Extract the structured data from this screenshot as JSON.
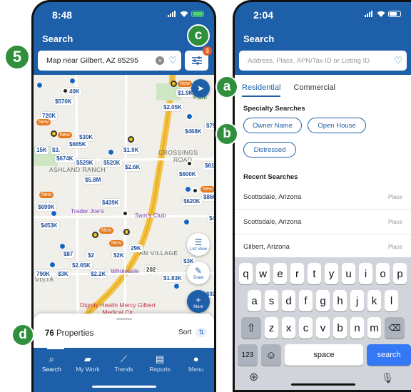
{
  "left_phone": {
    "status": {
      "time": "8:48"
    },
    "title": "Search",
    "search": {
      "value": "Map near Gilbert, AZ 85295",
      "clear_glyph": "×"
    },
    "filter_badge": "3",
    "map": {
      "price_pins": [
        "40K",
        "$570K",
        "720K",
        "$1.9K",
        "$2.05K",
        "Park",
        "New",
        "$30K",
        "$665K",
        "15K",
        "$3.",
        "$674K",
        "$529K",
        "$520K",
        "$1.9K",
        "$2.6K",
        "CROSSINGS",
        "$600K",
        "$610",
        "$468K",
        "$79",
        "$5.8M",
        "$860K",
        "$620K",
        "$439K",
        "$690K",
        "$453K",
        "$4",
        "$87",
        "$2",
        "29K",
        "$2.65K",
        "$2.2K",
        "$2K",
        "$3K",
        "790K",
        "$3K",
        "$1.83K",
        "$92"
      ],
      "new_tags": [
        "New",
        "New",
        "New",
        "New",
        "New",
        "New",
        "New"
      ],
      "labels": {
        "ashland": "ASHLAND RANCH",
        "village": "AN VILLAGE",
        "wholesale": "Wholesale",
        "vista": "VISTA",
        "road": "ROAD"
      },
      "pois": {
        "traderjoes": "Trader Joe's",
        "samsclub": "Sam's Club",
        "hospital": "Dignity Health Mercy Gilbert Medical Ctr",
        "hwy": "202"
      },
      "fabs": {
        "list_view": "List View",
        "draw": "Draw",
        "more": "More"
      }
    },
    "sheet": {
      "count": "76",
      "count_label": "Properties",
      "sort": "Sort"
    },
    "tabs": [
      {
        "label": "Search",
        "icon": "search-icon"
      },
      {
        "label": "My Work",
        "icon": "briefcase-icon"
      },
      {
        "label": "Trends",
        "icon": "chart-icon"
      },
      {
        "label": "Reports",
        "icon": "document-icon"
      },
      {
        "label": "Menu",
        "icon": "menu-icon"
      }
    ]
  },
  "right_phone": {
    "status": {
      "time": "2:04"
    },
    "title": "Search",
    "search": {
      "placeholder": "Address, Place, APN/Tax ID or Listing ID"
    },
    "segments": [
      "Residential",
      "Commercial"
    ],
    "specialty_heading": "Specialty Searches",
    "chips": [
      "Owner Name",
      "Open House",
      "Distressed"
    ],
    "recent_heading": "Recent Searches",
    "recent": [
      {
        "text": "Scottsdale, Arizona",
        "type": "Place"
      },
      {
        "text": "Scottsdale, Arizona",
        "type": "Place"
      },
      {
        "text": "Gilbert, Arizona",
        "type": "Place"
      }
    ],
    "keyboard": {
      "row1": [
        "q",
        "w",
        "e",
        "r",
        "t",
        "y",
        "u",
        "i",
        "o",
        "p"
      ],
      "row2": [
        "a",
        "s",
        "d",
        "f",
        "g",
        "h",
        "j",
        "k",
        "l"
      ],
      "row3": [
        "z",
        "x",
        "c",
        "v",
        "b",
        "n",
        "m"
      ],
      "numbers": "123",
      "space": "space",
      "search": "search"
    }
  },
  "callouts": {
    "five": "5",
    "a": "a",
    "b": "b",
    "c": "c",
    "d": "d"
  },
  "colors": {
    "brand": "#1d5fa8",
    "callout": "#2f8f3d",
    "new": "#e6791d"
  }
}
